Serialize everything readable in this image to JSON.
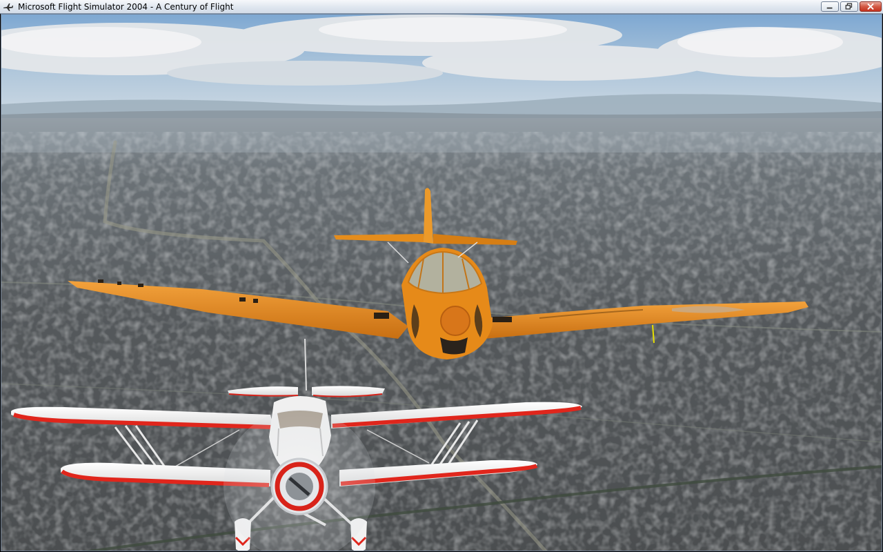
{
  "window": {
    "title": "Microsoft Flight Simulator 2004 - A Century of Flight",
    "icon": "airplane-icon",
    "controls": [
      "minimize-icon",
      "restore-icon",
      "close-icon"
    ]
  },
  "scene": {
    "type": "3d-flight-view",
    "colors": {
      "sky_top": "#8fb4d6",
      "haze": "#c7d4df",
      "terrain": "#5d6165",
      "monoplane_body": "#e48a1a",
      "biplane_body": "#f2f2f2",
      "biplane_stripe": "#e12a1e"
    }
  }
}
